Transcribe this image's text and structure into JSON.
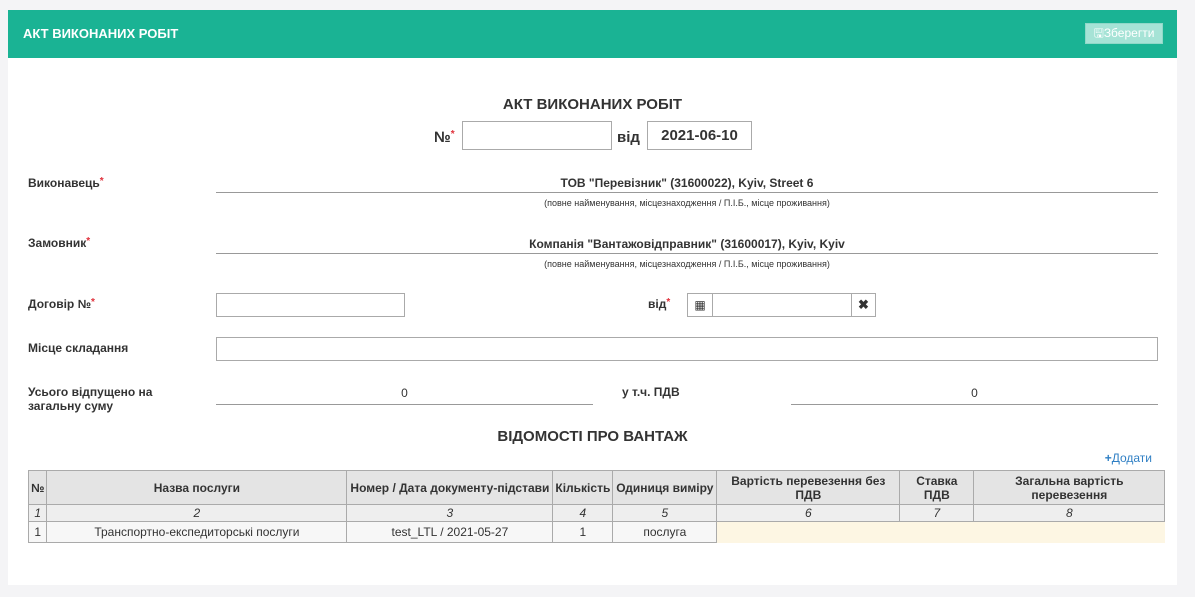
{
  "header": {
    "title": "АКТ ВИКОНАНИХ РОБІТ",
    "save_label": "Зберегти",
    "save_icon": "floppy-icon",
    "accent": "#1ab394"
  },
  "doc": {
    "title": "АКТ ВИКОНАНИХ РОБІТ",
    "number_label": "№",
    "number_value": "",
    "date_label": "від",
    "date_value": "2021-06-10"
  },
  "form": {
    "executor_label": "Виконавець",
    "executor_value": "ТОВ \"Перевізник\" (31600022), Kyiv, Street 6",
    "hint": "(повне найменування, місцезнаходження / П.І.Б., місце проживання)",
    "customer_label": "Замовник",
    "customer_value": "Компанія \"Вантажовідправник\" (31600017), Kyiv, Kyiv",
    "contract_label": "Договір №",
    "contract_date_label": "від",
    "place_label": "Місце складання",
    "total_label": "Усього відпущено на загальну суму",
    "total_value": "0",
    "vat_label": "у т.ч. ПДВ",
    "vat_value": "0"
  },
  "cargo": {
    "title": "ВІДОМОСТІ ПРО ВАНТАЖ",
    "add_label": "Додати",
    "columns": [
      "№",
      "Назва послуги",
      "Номер / Дата документу-підстави",
      "Кількість",
      "Одиниця виміру",
      "Вартість перевезення без ПДВ",
      "Ставка ПДВ",
      "Загальна вартість перевезення"
    ],
    "index": [
      "1",
      "2",
      "3",
      "4",
      "5",
      "6",
      "7",
      "8"
    ],
    "rows": [
      [
        "1",
        "Транспортно-експедиторські послуги",
        "test_LTL / 2021-05-27",
        "1",
        "послуга"
      ]
    ]
  }
}
